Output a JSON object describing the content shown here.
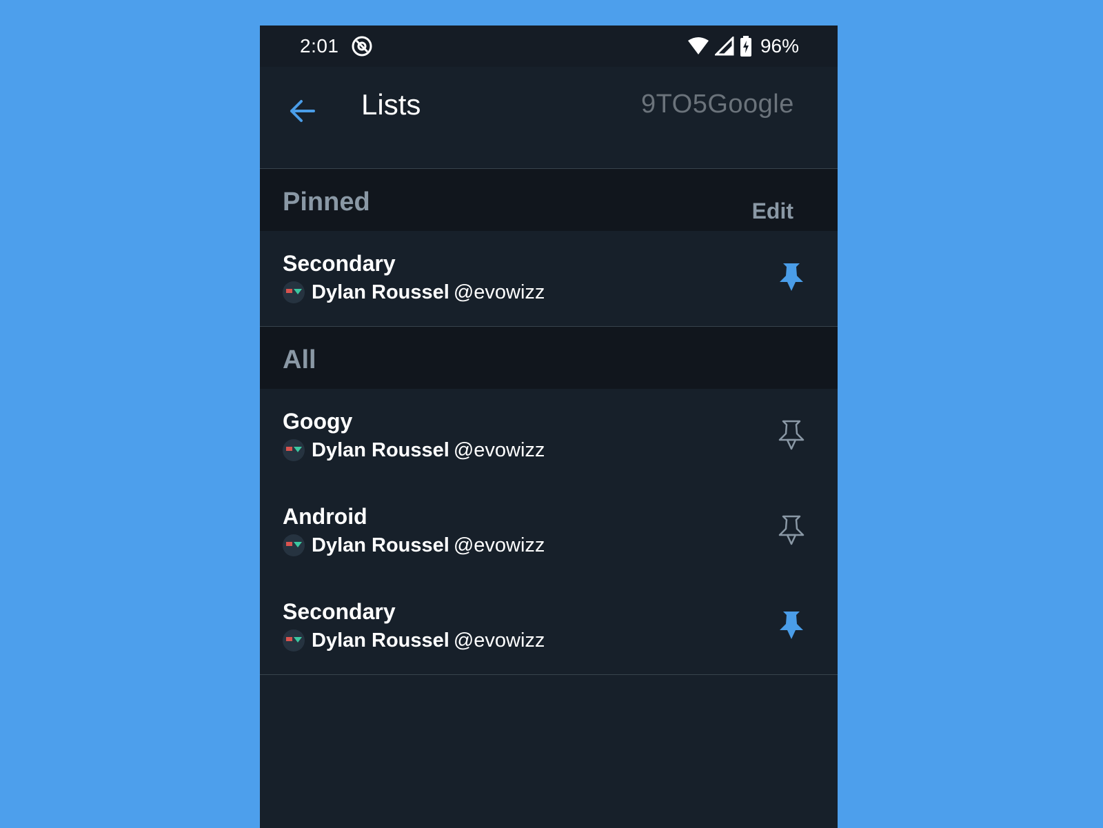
{
  "status_bar": {
    "time": "2:01",
    "battery": "96%"
  },
  "app_bar": {
    "title": "Lists",
    "watermark": "9TO5Google"
  },
  "pinned": {
    "title": "Pinned",
    "edit_label": "Edit",
    "items": [
      {
        "name": "Secondary",
        "owner": "Dylan Roussel",
        "handle": "@evowizz",
        "pinned": true
      }
    ]
  },
  "all": {
    "title": "All",
    "items": [
      {
        "name": "Googy",
        "owner": "Dylan Roussel",
        "handle": "@evowizz",
        "pinned": false
      },
      {
        "name": "Android",
        "owner": "Dylan Roussel",
        "handle": "@evowizz",
        "pinned": false
      },
      {
        "name": "Secondary",
        "owner": "Dylan Roussel",
        "handle": "@evowizz",
        "pinned": true
      }
    ]
  },
  "colors": {
    "accent": "#4a9de8",
    "background": "#17202a",
    "section_background": "#11161d",
    "muted_text": "#8a98a5",
    "page_background": "#4d9fec"
  },
  "icons": {
    "back": "arrow-left-icon",
    "pin_filled": "pin-filled-icon",
    "pin_outline": "pin-outline-icon",
    "wifi": "wifi-icon",
    "signal": "signal-icon",
    "battery": "battery-charging-icon"
  }
}
